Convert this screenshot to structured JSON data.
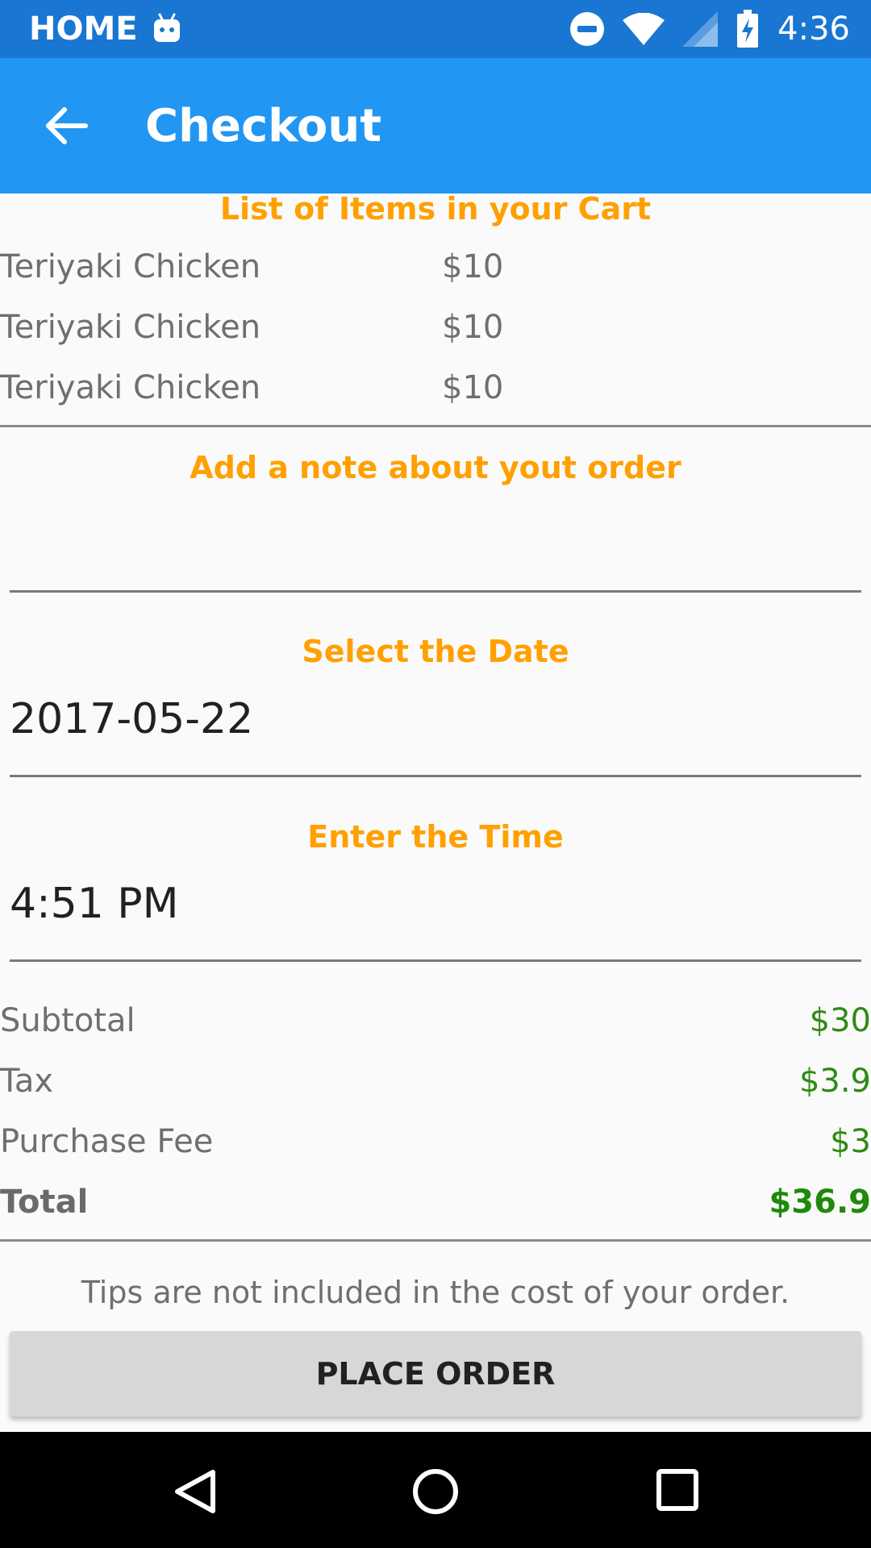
{
  "status_bar": {
    "carrier": "HOME",
    "time": "4:36",
    "icons": [
      "android-robot-icon",
      "do-not-disturb-icon",
      "wifi-icon",
      "signal-icon",
      "battery-charging-icon"
    ]
  },
  "app_bar": {
    "title": "Checkout",
    "back_icon": "arrow-back-icon"
  },
  "cart": {
    "heading": "List of Items in your Cart",
    "items": [
      {
        "name": "Teriyaki Chicken",
        "price": "$10"
      },
      {
        "name": "Teriyaki Chicken",
        "price": "$10"
      },
      {
        "name": "Teriyaki Chicken",
        "price": "$10"
      }
    ]
  },
  "note": {
    "heading": "Add a note about yout order",
    "value": ""
  },
  "date": {
    "heading": "Select the Date",
    "value": "2017-05-22"
  },
  "time": {
    "heading": "Enter the Time",
    "value": "4:51 PM"
  },
  "summary": {
    "subtotal_label": "Subtotal",
    "subtotal_value": "$30",
    "tax_label": "Tax",
    "tax_value": "$3.9",
    "fee_label": "Purchase Fee",
    "fee_value": "$3",
    "total_label": "Total",
    "total_value": "$36.9"
  },
  "tips_note": "Tips are not included in the cost of your order.",
  "place_order_label": "PLACE ORDER",
  "nav": {
    "icons": [
      "nav-back-icon",
      "nav-home-icon",
      "nav-recents-icon"
    ]
  },
  "colors": {
    "status_bar": "#1976d2",
    "app_bar": "#2196f3",
    "heading": "#ffa000",
    "money": "#2e8b13"
  }
}
